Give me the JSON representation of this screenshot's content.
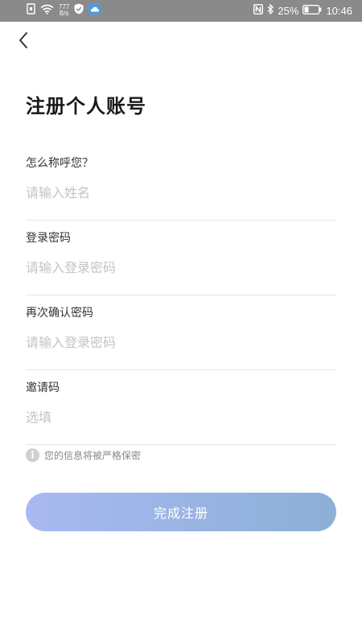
{
  "status_bar": {
    "network_speed_value": "777",
    "network_speed_unit": "B/s",
    "battery": "25%",
    "time": "10:46"
  },
  "page": {
    "title": "注册个人账号"
  },
  "form": {
    "name_label": "怎么称呼您？",
    "name_placeholder": "请输入姓名",
    "password_label": "登录密码",
    "password_placeholder": "请输入登录密码",
    "confirm_label": "再次确认密码",
    "confirm_placeholder": "请输入登录密码",
    "invite_label": "邀请码",
    "invite_placeholder": "选填"
  },
  "privacy_note": "您的信息将被严格保密",
  "submit_label": "完成注册",
  "colors": {
    "status_bar_bg": "#8a8a8a",
    "button_gradient_start": "#a9b9f2",
    "button_gradient_end": "#8cb0d6",
    "placeholder": "#c4c4c4"
  }
}
